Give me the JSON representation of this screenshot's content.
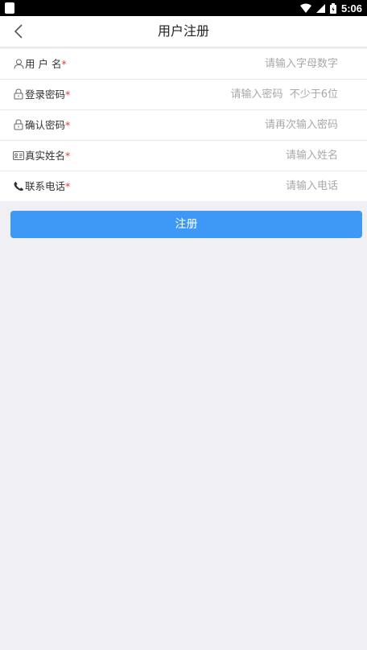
{
  "status_bar": {
    "time": "5:06"
  },
  "header": {
    "title": "用户注册"
  },
  "form": {
    "fields": [
      {
        "label": "用 户 名",
        "required_mark": "*",
        "placeholder": "请输入字母数字",
        "icon": "user-icon"
      },
      {
        "label": "登录密码",
        "required_mark": "*",
        "placeholder": "请输入密码  不少于6位",
        "icon": "lock-icon"
      },
      {
        "label": "确认密码",
        "required_mark": "*",
        "placeholder": "请再次输入密码",
        "icon": "lock-icon"
      },
      {
        "label": "真实姓名",
        "required_mark": "*",
        "placeholder": "请输入姓名",
        "icon": "id-card-icon"
      },
      {
        "label": "联系电话",
        "required_mark": "*",
        "placeholder": "请输入电话",
        "icon": "phone-icon"
      }
    ]
  },
  "actions": {
    "register_label": "注册"
  },
  "colors": {
    "primary": "#3d99f5",
    "required": "#e53935",
    "background": "#efeff4"
  }
}
